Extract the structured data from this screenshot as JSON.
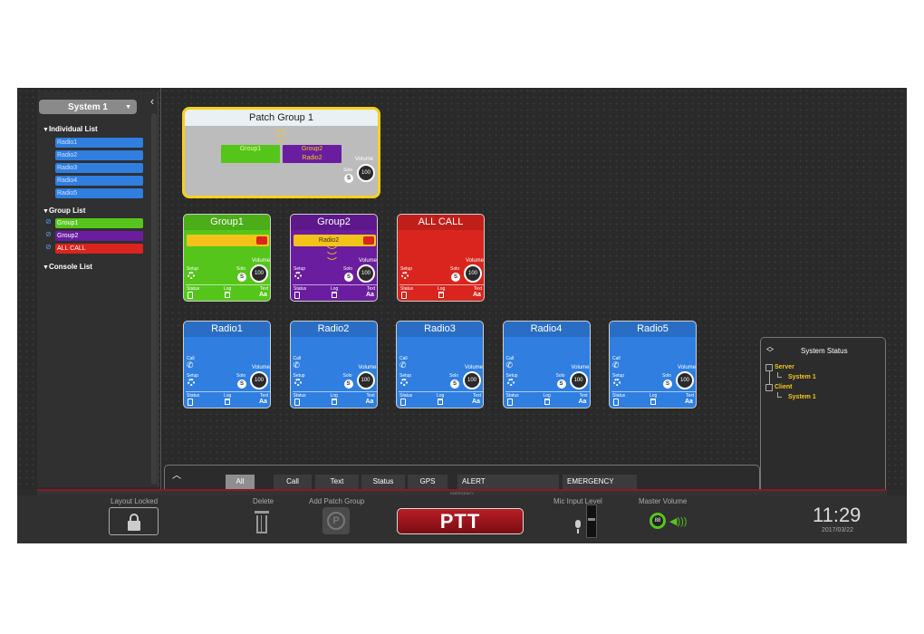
{
  "sidebar": {
    "system_select": "System 1",
    "individual_header": "Individual List",
    "individual_items": [
      {
        "label": "Radio1"
      },
      {
        "label": "Radio2"
      },
      {
        "label": "Radio3"
      },
      {
        "label": "Radio4"
      },
      {
        "label": "Radio5"
      }
    ],
    "group_header": "Group List",
    "group_items": [
      {
        "label": "Group1",
        "color": "#56c51b"
      },
      {
        "label": "Group2",
        "color": "#6a1d9e"
      },
      {
        "label": "ALL CALL",
        "color": "#d9251d"
      }
    ],
    "console_header": "Console List"
  },
  "patch_group": {
    "title": "Patch Group 1",
    "member1": "Group1",
    "member2_line1": "Group2",
    "member2_line2": "Radio2",
    "volume_label": "Volume",
    "solo_label": "Solo",
    "solo_letter": "S",
    "volume": "100"
  },
  "group_cards": [
    {
      "title": "Group1",
      "color": "#56c51b",
      "call_text": ""
    },
    {
      "title": "Group2",
      "color": "#6a1d9e",
      "call_text": "Radio2"
    },
    {
      "title": "ALL CALL",
      "color": "#d9251d",
      "call_text": ""
    }
  ],
  "radio_cards": [
    {
      "title": "Radio1"
    },
    {
      "title": "Radio2"
    },
    {
      "title": "Radio3"
    },
    {
      "title": "Radio4"
    },
    {
      "title": "Radio5"
    }
  ],
  "card_labels": {
    "call": "Call",
    "setup": "Setup",
    "solo": "Solo",
    "solo_letter": "S",
    "volume": "Volume",
    "volume_value": "100",
    "status": "Status",
    "log": "Log",
    "text": "Text",
    "text_icon": "Aa"
  },
  "system_status": {
    "title": "System Status",
    "server": "Server",
    "server_child": "System 1",
    "client": "Client",
    "client_child": "System 1"
  },
  "tabs": [
    {
      "label": "All",
      "active": true
    },
    {
      "label": "Call"
    },
    {
      "label": "Text"
    },
    {
      "label": "Status"
    },
    {
      "label": "GPS"
    },
    {
      "label": "ALERT"
    },
    {
      "label": "EMERGENCY"
    }
  ],
  "emergency_strip": "EMERGENCY",
  "controls": {
    "layout_locked": "Layout Locked",
    "delete": "Delete",
    "add_patch_group": "Add Patch Group",
    "ptt": "PTT",
    "mic_input_level": "Mic Input Level",
    "master_volume": "Master Volume",
    "master_volume_value": "88",
    "patch_letter": "P"
  },
  "clock": {
    "time": "11:29",
    "date": "2017/03/22"
  },
  "icons": [
    "lock-icon",
    "trash-icon",
    "patch-icon",
    "mic-icon",
    "speaker-icon",
    "gear-icon",
    "phone-icon",
    "hangup-icon",
    "signal-icon",
    "document-icon",
    "log-icon",
    "link-icon"
  ]
}
